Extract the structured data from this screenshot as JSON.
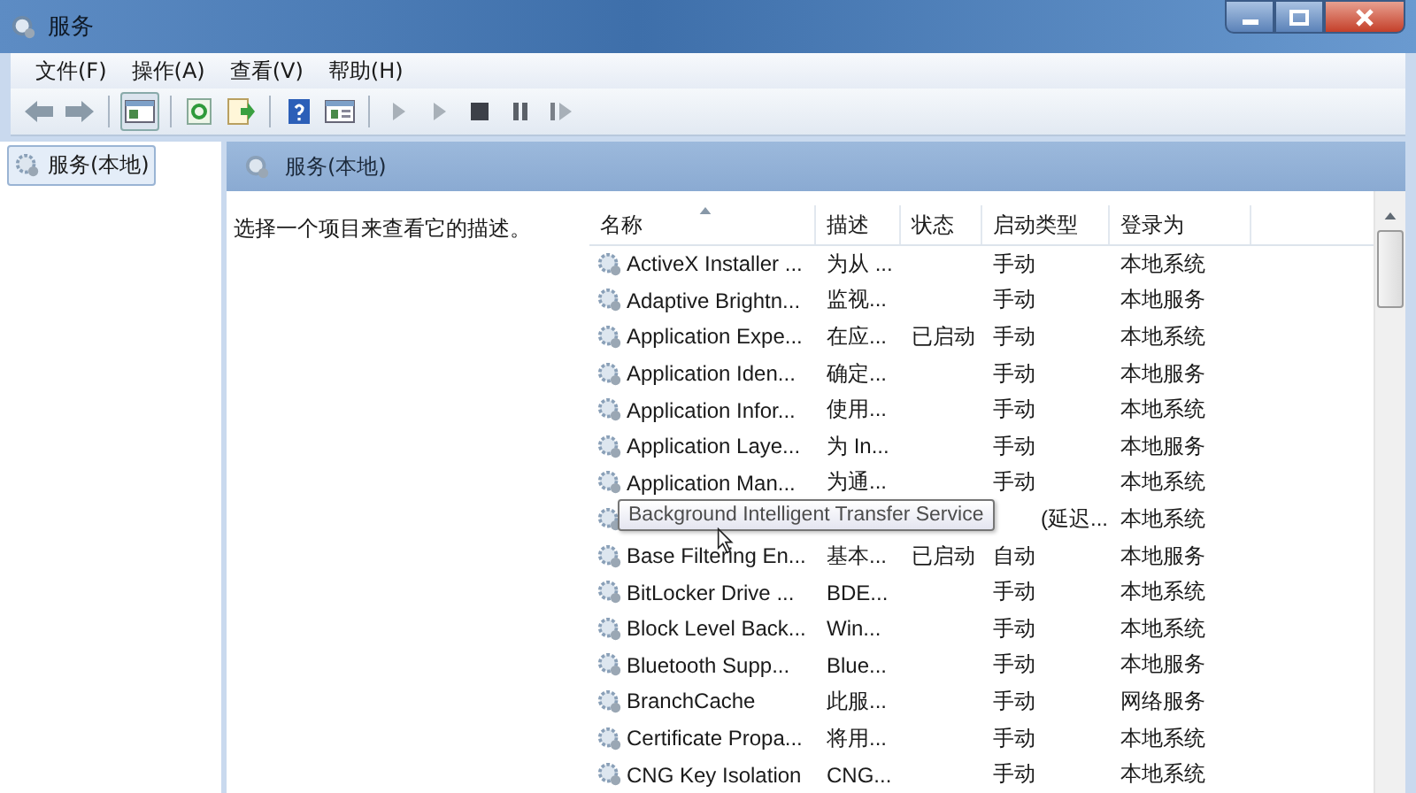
{
  "window": {
    "title": "服务"
  },
  "menu": [
    {
      "label": "文件(F)"
    },
    {
      "label": "操作(A)"
    },
    {
      "label": "查看(V)"
    },
    {
      "label": "帮助(H)"
    }
  ],
  "tree": {
    "items": [
      {
        "label": "服务(本地)",
        "selected": true
      }
    ]
  },
  "panel": {
    "title": "服务(本地)",
    "description": "选择一个项目来查看它的描述。"
  },
  "table": {
    "columns": [
      "名称",
      "描述",
      "状态",
      "启动类型",
      "登录为"
    ],
    "rows": [
      {
        "name": "ActiveX Installer ...",
        "desc": "为从 ...",
        "status": "",
        "start": "手动",
        "logon": "本地系统"
      },
      {
        "name": "Adaptive Brightn...",
        "desc": "监视...",
        "status": "",
        "start": "手动",
        "logon": "本地服务"
      },
      {
        "name": "Application Expe...",
        "desc": "在应...",
        "status": "已启动",
        "start": "手动",
        "logon": "本地系统"
      },
      {
        "name": "Application Iden...",
        "desc": "确定...",
        "status": "",
        "start": "手动",
        "logon": "本地服务"
      },
      {
        "name": "Application Infor...",
        "desc": "使用...",
        "status": "",
        "start": "手动",
        "logon": "本地系统"
      },
      {
        "name": "Application Laye...",
        "desc": "为 In...",
        "status": "",
        "start": "手动",
        "logon": "本地服务"
      },
      {
        "name": "Application Man...",
        "desc": "为通...",
        "status": "",
        "start": "手动",
        "logon": "本地系统"
      },
      {
        "tooltip": "Background Intelligent Transfer Service",
        "start": "(延迟...",
        "logon": "本地系统"
      },
      {
        "name": "Base Filtering En...",
        "desc": "基本...",
        "status": "已启动",
        "start": "自动",
        "logon": "本地服务"
      },
      {
        "name": "BitLocker Drive ...",
        "desc": "BDE...",
        "status": "",
        "start": "手动",
        "logon": "本地系统"
      },
      {
        "name": "Block Level Back...",
        "desc": "Win...",
        "status": "",
        "start": "手动",
        "logon": "本地系统"
      },
      {
        "name": "Bluetooth Supp...",
        "desc": "Blue...",
        "status": "",
        "start": "手动",
        "logon": "本地服务"
      },
      {
        "name": "BranchCache",
        "desc": "此服...",
        "status": "",
        "start": "手动",
        "logon": "网络服务"
      },
      {
        "name": "Certificate Propa...",
        "desc": "将用...",
        "status": "",
        "start": "手动",
        "logon": "本地系统"
      },
      {
        "name": "CNG Key Isolation",
        "desc": "CNG...",
        "status": "",
        "start": "手动",
        "logon": "本地系统"
      }
    ]
  }
}
